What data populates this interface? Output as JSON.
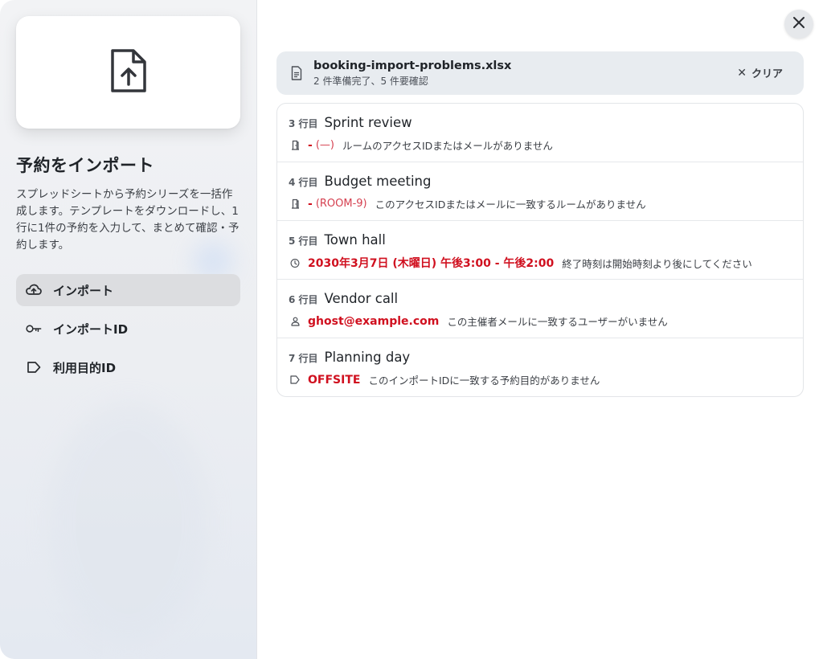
{
  "sidebar": {
    "title": "予約をインポート",
    "description": "スプレッドシートから予約シリーズを一括作成します。テンプレートをダウンロードし、1行に1件の予約を入力して、まとめて確認・予約します。",
    "nav": [
      {
        "label": "インポート",
        "icon": "cloud-upload-icon",
        "active": true
      },
      {
        "label": "インポートID",
        "icon": "key-icon",
        "active": false
      },
      {
        "label": "利用目的ID",
        "icon": "tag-icon",
        "active": false
      }
    ]
  },
  "file": {
    "name": "booking-import-problems.xlsx",
    "status": "2 件準備完了、5 件要確認",
    "clear_label": "クリア"
  },
  "rows": [
    {
      "row": "3 行目",
      "title": "Sprint review",
      "icon": "door-icon",
      "error": "-",
      "error_extra": "(—)",
      "message": "ルームのアクセスIDまたはメールがありません"
    },
    {
      "row": "4 行目",
      "title": "Budget meeting",
      "icon": "door-icon",
      "error": "-",
      "error_extra": "(ROOM-9)",
      "message": "このアクセスIDまたはメールに一致するルームがありません"
    },
    {
      "row": "5 行目",
      "title": "Town hall",
      "icon": "clock-icon",
      "error": "2030年3月7日 (木曜日) 午後3:00 - 午後2:00",
      "error_extra": "",
      "message": "終了時刻は開始時刻より後にしてください"
    },
    {
      "row": "6 行目",
      "title": "Vendor call",
      "icon": "person-icon",
      "error": "ghost@example.com",
      "error_extra": "",
      "message": "この主催者メールに一致するユーザーがいません"
    },
    {
      "row": "7 行目",
      "title": "Planning day",
      "icon": "tag-icon",
      "error": "OFFSITE",
      "error_extra": "",
      "message": "このインポートIDに一致する予約目的がありません"
    }
  ],
  "colors": {
    "error": "#d0101f",
    "error_light": "#d54050",
    "active_nav": "#dcdde0",
    "file_bar": "#e8ecf0"
  }
}
